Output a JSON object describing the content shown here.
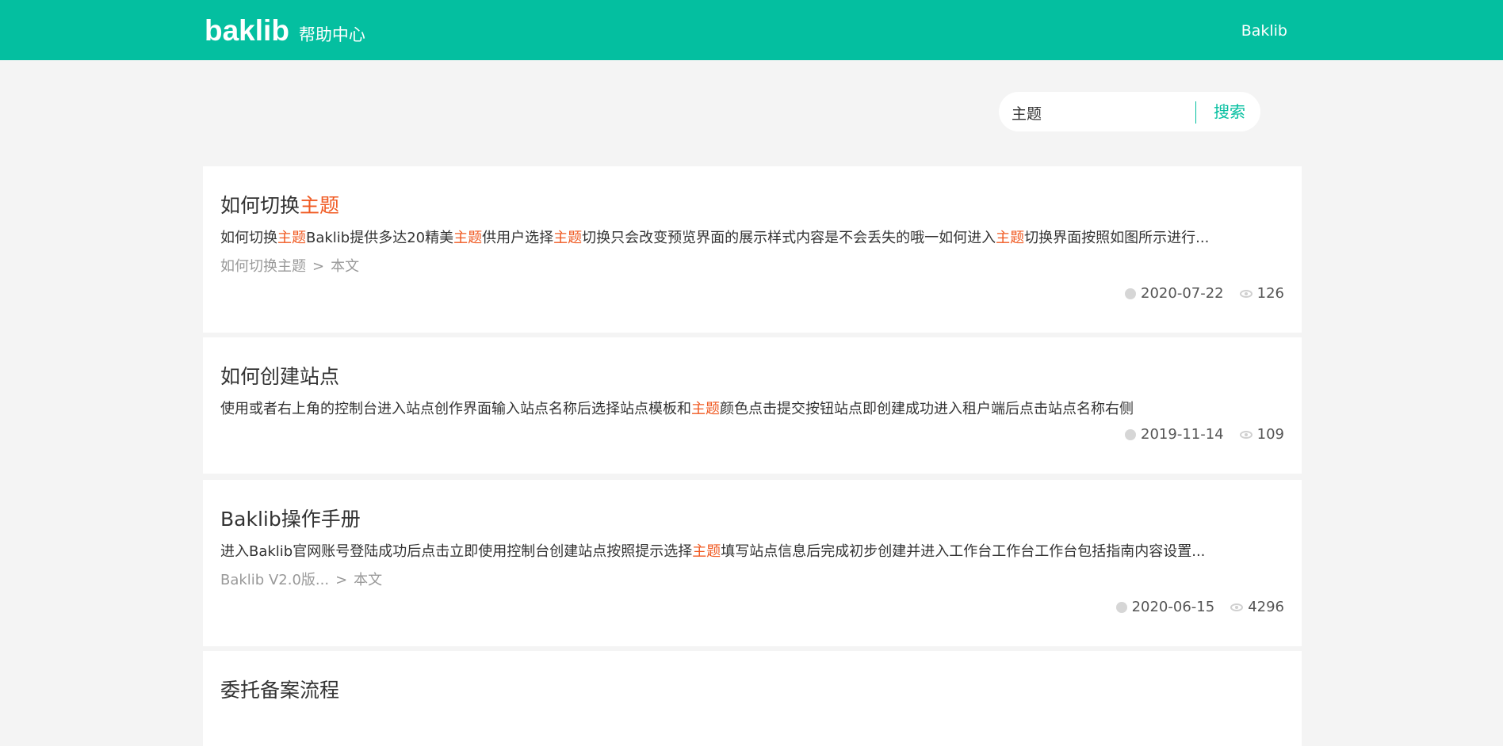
{
  "header": {
    "logo_text": "baklib",
    "subtitle": "帮助中心",
    "right_link": "Baklib"
  },
  "search": {
    "value": "主题",
    "button_label": "搜索"
  },
  "results": [
    {
      "title_parts": [
        {
          "text": "如何切换",
          "hl": false
        },
        {
          "text": "主题",
          "hl": true
        }
      ],
      "snippet_parts": [
        {
          "text": "如何切换",
          "hl": false
        },
        {
          "text": "主题",
          "hl": true
        },
        {
          "text": "Baklib提供多达20精美",
          "hl": false
        },
        {
          "text": "主题",
          "hl": true
        },
        {
          "text": "供用户选择",
          "hl": false
        },
        {
          "text": "主题",
          "hl": true
        },
        {
          "text": "切换只会改变预览界面的展示样式内容是不会丢失的哦一如何进入",
          "hl": false
        },
        {
          "text": "主题",
          "hl": true
        },
        {
          "text": "切换界面按照如图所示进行...",
          "hl": false
        }
      ],
      "path": "如何切换主题",
      "path_leaf": "本文",
      "date": "2020-07-22",
      "views": "126"
    },
    {
      "title_parts": [
        {
          "text": "如何创建站点",
          "hl": false
        }
      ],
      "snippet_parts": [
        {
          "text": "使用或者右上角的控制台进入站点创作界面输入站点名称后选择站点模板和",
          "hl": false
        },
        {
          "text": "主题",
          "hl": true
        },
        {
          "text": "颜色点击提交按钮站点即创建成功进入租户端后点击站点名称右侧",
          "hl": false
        }
      ],
      "path": "",
      "path_leaf": "",
      "date": "2019-11-14",
      "views": "109"
    },
    {
      "title_parts": [
        {
          "text": "Baklib操作手册",
          "hl": false
        }
      ],
      "snippet_parts": [
        {
          "text": "进入Baklib官网账号登陆成功后点击立即使用控制台创建站点按照提示选择",
          "hl": false
        },
        {
          "text": "主题",
          "hl": true
        },
        {
          "text": "填写站点信息后完成初步创建并进入工作台工作台工作台包括指南内容设置...",
          "hl": false
        }
      ],
      "path": "Baklib V2.0版...",
      "path_leaf": "本文",
      "date": "2020-06-15",
      "views": "4296"
    },
    {
      "title_parts": [
        {
          "text": "委托备案流程",
          "hl": false
        }
      ],
      "snippet_parts": [],
      "path": "",
      "path_leaf": "",
      "date": "",
      "views": ""
    }
  ],
  "colors": {
    "brand": "#04bfa0",
    "highlight": "#f05a22"
  },
  "icons": {
    "date": "clock-icon",
    "views": "eye-icon"
  }
}
